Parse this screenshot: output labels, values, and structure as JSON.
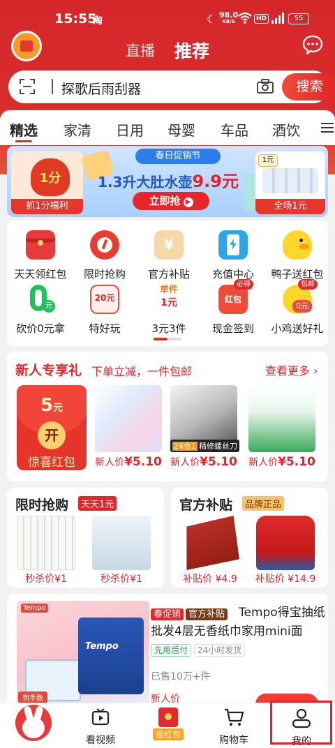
{
  "status_bar": {
    "time": "15:55",
    "app_badge": "淘",
    "speed_value": "98.0",
    "speed_unit": "KB/S",
    "hd": "HD",
    "battery": "55"
  },
  "header": {
    "tab_live": "直播",
    "tab_recommend": "推荐"
  },
  "search": {
    "query": "探歌后雨刮器",
    "button": "搜索"
  },
  "categories": [
    "精选",
    "家清",
    "日用",
    "母婴",
    "车品",
    "酒饮"
  ],
  "banner": {
    "left_amount": "1分",
    "left_button": "抓1分福利",
    "tag": "春日促销节",
    "headline_prefix": "1.3升大肚水壶",
    "headline_price": "9.9元",
    "cta": "立即抢",
    "right_badge": "1元",
    "right_button": "全场1元"
  },
  "quick_actions": [
    {
      "label": "天天领红包",
      "icon": "red-envelope-icon"
    },
    {
      "label": "限时抢购",
      "icon": "alarm-clock-icon"
    },
    {
      "label": "官方补贴",
      "icon": "coupon-ticket-icon"
    },
    {
      "label": "充值中心",
      "icon": "phone-recharge-icon"
    },
    {
      "label": "鸭子送红包",
      "icon": "duck-icon"
    },
    {
      "label": "砍价0元拿",
      "icon": "zero-yuan-icon"
    },
    {
      "label": "特好玩",
      "icon": "game-coupon-icon",
      "icon_text": "20元"
    },
    {
      "label": "3元3件",
      "icon": "single-item-icon",
      "icon_text_top": "单件",
      "icon_text_bottom": "1元"
    },
    {
      "label": "现金签到",
      "icon": "cash-signin-icon",
      "badge": "必得",
      "icon_text": "红包"
    },
    {
      "label": "小鸡送好礼",
      "icon": "chick-gift-icon",
      "badge": "包邮",
      "icon_text": "0元"
    }
  ],
  "new_user": {
    "title": "新人专享礼",
    "subtitle": "下单立减，一件包邮",
    "more": "查看更多",
    "redpack_amount": "5",
    "redpack_unit": "元",
    "redpack_open": "开",
    "redpack_label": "惊喜红包",
    "products": [
      {
        "price_label": "新人价",
        "price": "¥5.10"
      },
      {
        "price_label": "新人价",
        "price": "¥5.10",
        "tag_a": "24合1",
        "tag_b": "精修螺丝刀"
      },
      {
        "price_label": "新人价",
        "price": "¥5.10"
      }
    ]
  },
  "flash_sale": {
    "title": "限时抢购",
    "tag": "天天1元",
    "items": [
      {
        "price": "秒杀价¥1"
      },
      {
        "price": "秒杀价¥1"
      }
    ]
  },
  "subsidy": {
    "title": "官方补贴",
    "tag": "品牌正品",
    "items": [
      {
        "price": "补贴价 ¥4.9"
      },
      {
        "price": "补贴价 ¥14.9"
      }
    ]
  },
  "feed_item": {
    "tag1": "春促销",
    "tag2": "官方补贴",
    "title": "Tempo得宝抽纸批发4层无香纸巾家用mini面",
    "chip1": "先用后付",
    "chip2": "24小时发货",
    "sold": "已售10万+件",
    "new_price_label": "新人价",
    "image_logo": "Tempo",
    "image_pack_label": "Tempo",
    "image_corner": "到手数"
  },
  "bottom_nav": [
    {
      "label": "看视频"
    },
    {
      "label": "摇红包"
    },
    {
      "label": "购物车"
    },
    {
      "label": "我的"
    }
  ],
  "colors": {
    "brand_red": "#e22a2a",
    "header_red": "#d5262a",
    "search_button": "#e3242a"
  }
}
